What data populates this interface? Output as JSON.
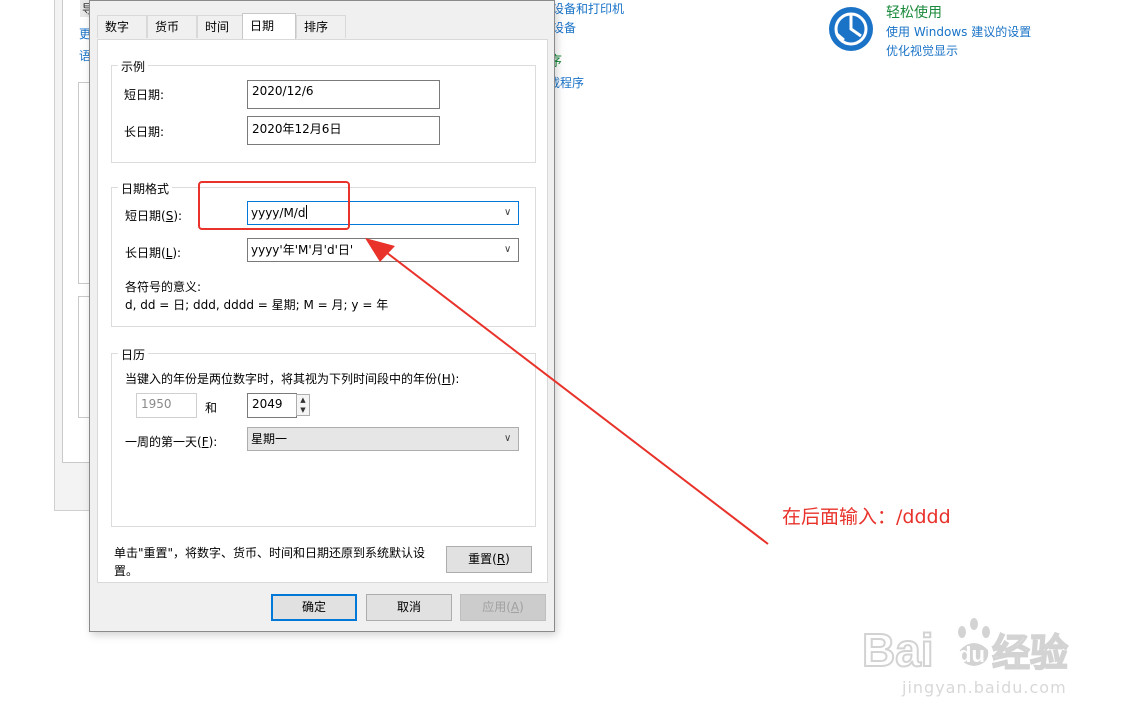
{
  "background_panel": {
    "link_devices": "看设备和打印机",
    "link_add_device": "加设备",
    "heading_programs": "序",
    "link_programs": "载程序",
    "left_frag_1": "导",
    "left_frag_2": "更",
    "left_frag_3": "语",
    "ease_title": "轻松使用",
    "ease_link_1": "使用 Windows 建议的设置",
    "ease_link_2": "优化视觉显示"
  },
  "dialog": {
    "tabs": [
      {
        "label": "数字"
      },
      {
        "label": "货币"
      },
      {
        "label": "时间"
      },
      {
        "label": "日期"
      },
      {
        "label": "排序"
      }
    ],
    "active_tab": "日期",
    "examples": {
      "title": "示例",
      "short_label": "短日期:",
      "short_value": "2020/12/6",
      "long_label": "长日期:",
      "long_value": "2020年12月6日"
    },
    "date_formats": {
      "title": "日期格式",
      "short_label_pre": "短日期(",
      "short_label_key": "S",
      "short_label_post": "):",
      "short_value": "yyyy/M/d",
      "long_label_pre": "长日期(",
      "long_label_key": "L",
      "long_label_post": "):",
      "long_value": "yyyy'年'M'月'd'日'",
      "legend_title": "各符号的意义:",
      "legend_text": "d, dd = 日;  ddd, dddd = 星期;  M = 月;  y = 年"
    },
    "calendar": {
      "title": "日历",
      "twodigit_pre": "当键入的年份是两位数字时，将其视为下列时间段中的年份(",
      "twodigit_key": "H",
      "twodigit_post": "):",
      "year_from": "1950",
      "and_label": "和",
      "year_to": "2049",
      "first_day_pre": "一周的第一天(",
      "first_day_key": "F",
      "first_day_post": "):",
      "first_day_value": "星期一"
    },
    "reset_text_line1": "单击\"重置\"，将数字、货币、时间和日期还原到系统默认设",
    "reset_text_line2": "置。",
    "reset_pre": "重置(",
    "reset_key": "R",
    "reset_post": ")",
    "ok_label": "确定",
    "cancel_label": "取消",
    "apply_pre": "应用(",
    "apply_key": "A",
    "apply_post": ")"
  },
  "annotation": {
    "text": "在后面输入：/dddd",
    "color": "#e8322a"
  },
  "watermark": {
    "brand_latin_1": "Bai",
    "brand_latin_2": "du",
    "brand_cn": "经验",
    "url": "jingyan.baidu.com"
  },
  "colors": {
    "accent": "#0078d7",
    "link": "#1a73c7",
    "green_heading": "#1a8a3c",
    "annotation_red": "#e8322a"
  }
}
